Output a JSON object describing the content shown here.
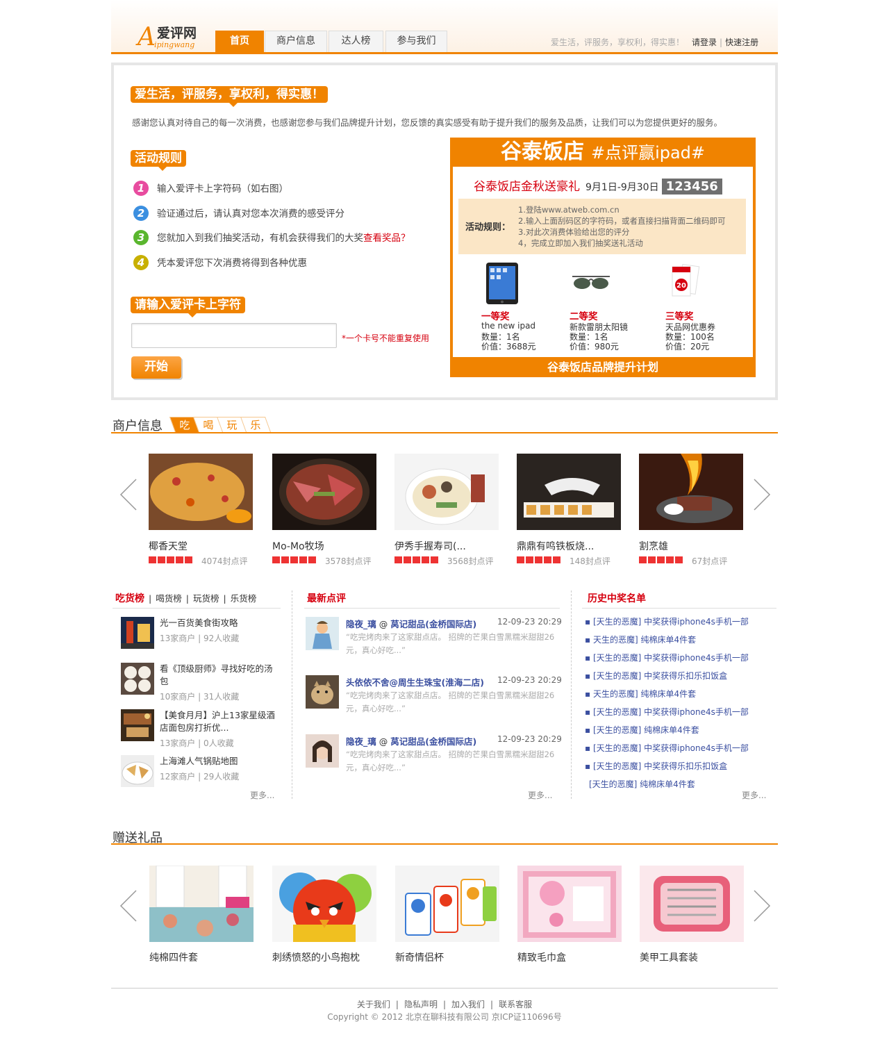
{
  "logo": {
    "mark": "A",
    "cn": "爱评网",
    "en": "ipingwang"
  },
  "nav": {
    "tabs": [
      "首页",
      "商户信息",
      "达人榜",
      "参与我们"
    ],
    "active": 0
  },
  "slogan": "爱生活，评服务，享权利，得实惠！",
  "login": {
    "login": "请登录",
    "register": "快速注册"
  },
  "hero": {
    "badge": "爱生活，评服务，享权利，得实惠！",
    "desc": "感谢您认真对待自己的每一次消费，也感谢您参与我们品牌提升计划，您反馈的真实感受有助于提升我们的服务及品质，让我们可以为您提供更好的服务。",
    "rules_badge": "活动规则",
    "rules": [
      {
        "num": "1",
        "text": "输入爱评卡上字符码（如右图）",
        "color": "#e84c9f"
      },
      {
        "num": "2",
        "text": "验证通过后，请认真对您本次消费的感受评分",
        "color": "#3b8fe0"
      },
      {
        "num": "3",
        "text": "您就加入到我们抽奖活动，有机会获得我们的大奖",
        "link": "查看奖品？",
        "color": "#5ab62e"
      },
      {
        "num": "4",
        "text": "凭本爱评您下次消费将得到各种优惠",
        "color": "#c8b000"
      }
    ],
    "input_badge": "请输入爱评卡上字符",
    "input_placeholder": "",
    "input_note": "*一个卡号不能重复使用",
    "start": "开始"
  },
  "card": {
    "brand": "谷泰饭店",
    "tag": "#点评赢ipad#",
    "sub_title": "谷泰饭店金秋送豪礼",
    "dates": "9月1日-9月30日",
    "code": "123456",
    "rules_label": "活动规则：",
    "rules": [
      "1.登陆www.atweb.com.cn",
      "2.输入上面刮码区的字符码，或者直接扫描背面二维码即可",
      "3.对此次消费体验给出您的评分",
      "4，完成立即加入我们抽奖送礼活动"
    ],
    "prizes": [
      {
        "level": "一等奖",
        "name": "the new ipad",
        "qty": "数量：1名",
        "price": "价值：3688元",
        "icon": "ipad-icon"
      },
      {
        "level": "二等奖",
        "name": "新款雷朋太阳镜",
        "qty": "数量：1名",
        "price": "价值：980元",
        "icon": "sunglasses-icon"
      },
      {
        "level": "三等奖",
        "name": "天品网优惠券",
        "qty": "数量：100名",
        "price": "价值：20元",
        "icon": "coupon-icon"
      }
    ],
    "footer": "谷泰饭店品牌提升计划"
  },
  "merchants": {
    "title": "商户信息",
    "tabs": [
      "吃",
      "喝",
      "玩",
      "乐"
    ],
    "items": [
      {
        "name": "椰香天堂",
        "count": "4074封点评"
      },
      {
        "name": "Mo-Mo牧场",
        "count": "3578封点评"
      },
      {
        "name": "伊秀手握寿司(...",
        "count": "3568封点评"
      },
      {
        "name": "鼎鼎有鸣铁板烧...",
        "count": "148封点评"
      },
      {
        "name": "割烹雄",
        "count": "67封点评"
      }
    ]
  },
  "rankings": {
    "tabs": [
      "吃货榜",
      "喝货榜",
      "玩货榜",
      "乐货榜"
    ],
    "items": [
      {
        "title": "光一百货美食街攻略",
        "meta1": "13家商户",
        "meta2": "92人收藏"
      },
      {
        "title": "看《顶级厨师》寻找好吃的汤包",
        "meta1": "10家商户",
        "meta2": "31人收藏"
      },
      {
        "title": "【美食月月】沪上13家星级酒店面包房打折优...",
        "meta1": "13家商户",
        "meta2": "0人收藏"
      },
      {
        "title": "上海滩人气锅贴地图",
        "meta1": "12家商户",
        "meta2": "29人收藏"
      }
    ],
    "more": "更多..."
  },
  "reviews": {
    "title": "最新点评",
    "items": [
      {
        "user": "隐夜_璃",
        "shop": "莴记甜品(金桥国际店)",
        "date": "12-09-23 20:29",
        "content": "“吃完烤肉来了这家甜点店。 招牌的芒果白雪黑糯米甜甜26元，真心好吃...”"
      },
      {
        "user": "头依依不舍@周生生珠宝(淮海二店)",
        "shop": "",
        "date": "12-09-23 20:29",
        "content": "“吃完烤肉来了这家甜点店。 招牌的芒果白雪黑糯米甜甜26元，真心好吃...”"
      },
      {
        "user": "隐夜_璃",
        "shop": "莴记甜品(金桥国际店)",
        "date": "12-09-23 20:29",
        "content": "“吃完烤肉来了这家甜点店。 招牌的芒果白雪黑糯米甜甜26元，真心好吃...”"
      }
    ],
    "more": "更多..."
  },
  "winners": {
    "title": "历史中奖名单",
    "items": [
      "▪ [天生的恶魔] 中奖获得iphone4s手机一部",
      "▪ 天生的恶魔] 纯棉床单4件套",
      "▪ [天生的恶魔] 中奖获得iphone4s手机一部",
      "▪ [天生的恶魔] 中奖获得乐扣乐扣饭盒",
      "▪ 天生的恶魔] 纯棉床单4件套",
      "▪ [天生的恶魔] 中奖获得iphone4s手机一部",
      "▪ [天生的恶魔] 纯棉床单4件套",
      "▪ [天生的恶魔] 中奖获得iphone4s手机一部",
      "▪ [天生的恶魔] 中奖获得乐扣乐扣饭盒",
      "[天生的恶魔] 纯棉床单4件套"
    ],
    "more": "更多..."
  },
  "gifts": {
    "title": "赠送礼品",
    "items": [
      "纯棉四件套",
      "刺绣愤怒的小鸟抱枕",
      "新奇情侣杯",
      "精致毛巾盒",
      "美甲工具套装"
    ]
  },
  "footer": {
    "links": [
      "关于我们",
      "隐私声明",
      "加入我们",
      "联系客服"
    ],
    "copyright": "Copyright © 2012 北京在聊科技有限公司   京ICP证110696号"
  },
  "colors": {
    "accent": "#f08300",
    "red": "#d6000f",
    "link": "#3b4fa0"
  }
}
